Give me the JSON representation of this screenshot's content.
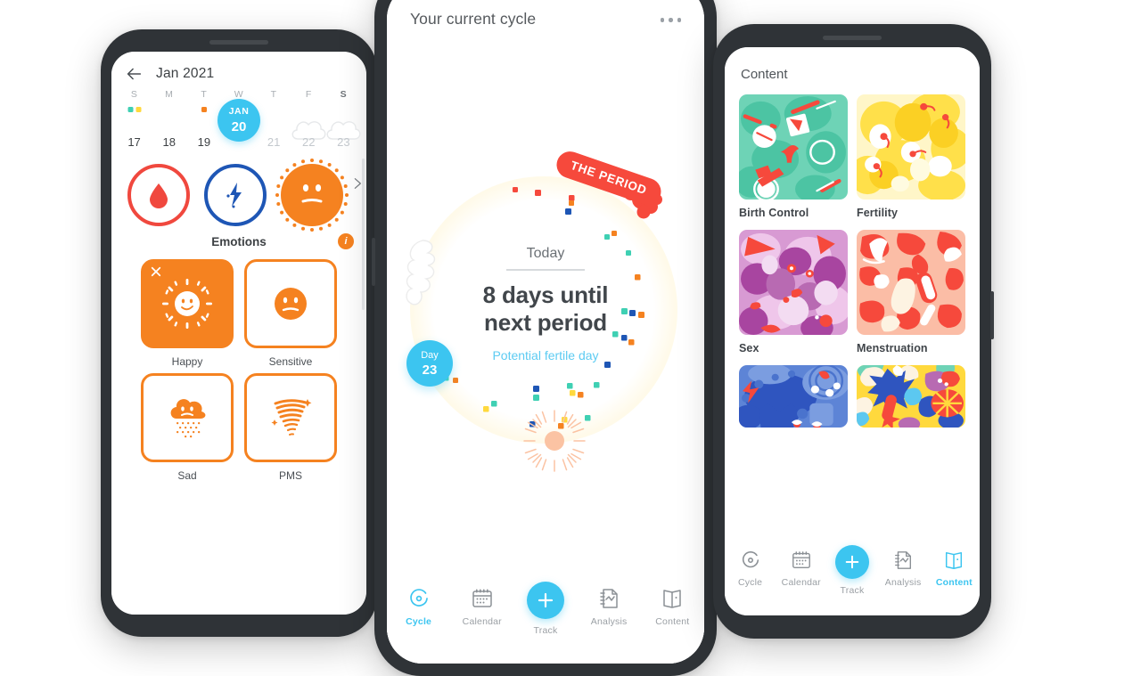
{
  "colors": {
    "accent_blue": "#3cc5f0",
    "accent_orange": "#f58220",
    "accent_red": "#f6493c",
    "ring_blue": "#1e56b5",
    "text_dark": "#3d4144",
    "text_muted": "#9ba0a5",
    "page_background": "#ffffff",
    "phone_frame": "#2f3337"
  },
  "left_phone": {
    "header": {
      "back_icon": "back-arrow-icon",
      "month_label": "Jan 2021"
    },
    "weekday_initials": [
      "S",
      "M",
      "T",
      "W",
      "T",
      "F",
      "S"
    ],
    "days": [
      {
        "num": "17",
        "today": false,
        "dimmed": false,
        "cloud": false,
        "dots": [
          "#3fd0b3",
          "#ffd93d"
        ]
      },
      {
        "num": "18",
        "today": false,
        "dimmed": false,
        "cloud": false,
        "dots": []
      },
      {
        "num": "19",
        "today": false,
        "dimmed": false,
        "cloud": false,
        "dots": [
          "#f58220"
        ]
      },
      {
        "num": "20",
        "today": true,
        "dimmed": false,
        "cloud": false,
        "dots": [],
        "today_month": "JAN",
        "today_day": "20"
      },
      {
        "num": "21",
        "today": false,
        "dimmed": true,
        "cloud": false,
        "dots": []
      },
      {
        "num": "22",
        "today": false,
        "dimmed": true,
        "cloud": true,
        "dots": []
      },
      {
        "num": "23",
        "today": false,
        "dimmed": true,
        "cloud": true,
        "dots": []
      }
    ],
    "trackers": [
      {
        "name": "period-tracker",
        "icon": "blood-drop-icon",
        "style": "ring-red"
      },
      {
        "name": "symptoms-tracker",
        "icon": "lightning-bolt-icon",
        "style": "ring-blue"
      },
      {
        "name": "emotions-tracker",
        "icon": "neutral-face-icon",
        "style": "solid-orange"
      }
    ],
    "next_arrow_icon": "chevron-right-icon",
    "section_title": "Emotions",
    "info_badge": "i",
    "emotions": [
      {
        "label": "Happy",
        "icon": "sun-smile-icon",
        "selected": true,
        "close_icon": "close-icon"
      },
      {
        "label": "Sensitive",
        "icon": "neutral-face-icon",
        "selected": false
      },
      {
        "label": "Sad",
        "icon": "rain-cloud-icon",
        "selected": false
      },
      {
        "label": "PMS",
        "icon": "tornado-icon",
        "selected": false
      }
    ]
  },
  "center_phone": {
    "header": {
      "title": "Your current cycle",
      "menu_icon": "more-options-icon"
    },
    "period_tag": "THE PERIOD",
    "today_label": "Today",
    "headline": "8 days until next period",
    "headline_line1": "8 days until",
    "headline_line2": "next period",
    "subtext": "Potential fertile day",
    "day_bubble": {
      "label": "Day",
      "number": "23"
    },
    "nav": [
      {
        "label": "Cycle",
        "icon": "cycle-icon",
        "active": true
      },
      {
        "label": "Calendar",
        "icon": "calendar-icon",
        "active": false
      },
      {
        "label": "Track",
        "icon": "plus-icon",
        "active": false,
        "fab": true
      },
      {
        "label": "Analysis",
        "icon": "analysis-chart-icon",
        "active": false
      },
      {
        "label": "Content",
        "icon": "book-icon",
        "active": false
      }
    ]
  },
  "right_phone": {
    "title": "Content",
    "cards": [
      {
        "label": "Birth Control",
        "thumb": "birth-control-thumbnail",
        "base": "#6ed3b6",
        "mid": "#4cc4a3",
        "accent": "#f6493c",
        "light": "#ffffff"
      },
      {
        "label": "Fertility",
        "thumb": "fertility-thumbnail",
        "base": "#ffe06b",
        "mid": "#fbd024",
        "accent": "#f6493c",
        "light": "#fffbe0"
      },
      {
        "label": "Sex",
        "thumb": "sex-thumbnail",
        "base": "#d89ad3",
        "mid": "#a845a0",
        "accent": "#f6493c",
        "light": "#f3dcf2"
      },
      {
        "label": "Menstruation",
        "thumb": "menstruation-thumbnail",
        "base": "#fbbda6",
        "mid": "#f6493c",
        "accent": "#ffffff",
        "light": "#fdf3e2"
      },
      {
        "label": "",
        "thumb": "wellbeing-thumbnail",
        "base": "#5d84d6",
        "mid": "#2f55bf",
        "accent": "#f6493c",
        "light": "#ffffff"
      },
      {
        "label": "",
        "thumb": "lifestyle-thumbnail",
        "base": "#ffd93d",
        "mid": "#2f55bf",
        "accent": "#f6493c",
        "light": "#6ed3b6"
      }
    ],
    "nav": [
      {
        "label": "Cycle",
        "icon": "cycle-icon",
        "active": false
      },
      {
        "label": "Calendar",
        "icon": "calendar-icon",
        "active": false
      },
      {
        "label": "Track",
        "icon": "plus-icon",
        "active": false,
        "fab": true
      },
      {
        "label": "Analysis",
        "icon": "analysis-chart-icon",
        "active": false
      },
      {
        "label": "Content",
        "icon": "book-icon",
        "active": true
      }
    ]
  }
}
